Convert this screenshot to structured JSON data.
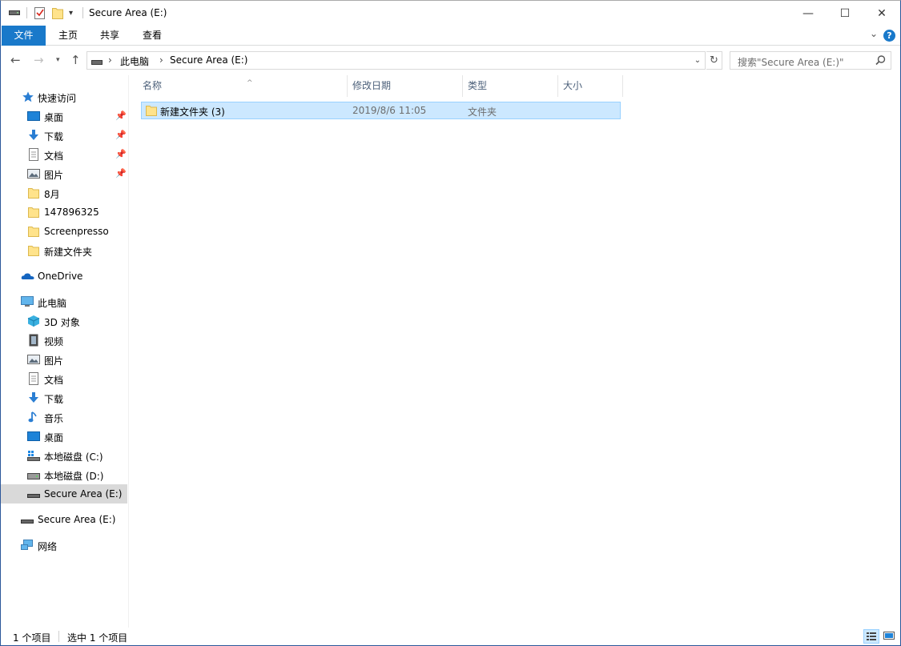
{
  "window": {
    "title": "Secure Area (E:)",
    "minimize_glyph": "—",
    "maximize_glyph": "☐",
    "close_glyph": "✕"
  },
  "ribbon": {
    "tabs": [
      "文件",
      "主页",
      "共享",
      "查看"
    ],
    "help_glyph": "?",
    "accent": "#1979ca"
  },
  "address": {
    "crumbs": [
      "此电脑",
      "Secure Area (E:)"
    ],
    "search_placeholder": "搜索\"Secure Area (E:)\""
  },
  "nav": {
    "quick_access": "快速访问",
    "quick_items": [
      "桌面",
      "下载",
      "文档",
      "图片",
      "8月",
      "147896325",
      "Screenpresso",
      "新建文件夹"
    ],
    "onedrive": "OneDrive",
    "this_pc": "此电脑",
    "pc_items": [
      "3D 对象",
      "视频",
      "图片",
      "文档",
      "下载",
      "音乐",
      "桌面",
      "本地磁盘 (C:)",
      "本地磁盘 (D:)",
      "Secure Area (E:)"
    ],
    "drive_e": "Secure Area (E:)",
    "network": "网络"
  },
  "columns": [
    "名称",
    "修改日期",
    "类型",
    "大小"
  ],
  "files": [
    {
      "name": "新建文件夹 (3)",
      "date": "2019/8/6 11:05",
      "type": "文件夹",
      "size": ""
    }
  ],
  "status": {
    "count": "1 个项目",
    "selected": "选中 1 个项目"
  }
}
